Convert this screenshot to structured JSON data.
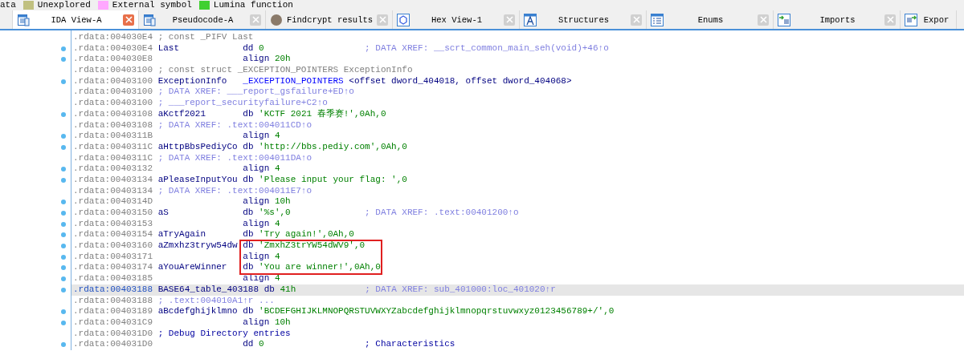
{
  "legend": [
    {
      "label": "ata"
    },
    {
      "label": "Unexplored",
      "color": "#c0c080"
    },
    {
      "label": "External symbol",
      "color": "#ffa8ff"
    },
    {
      "label": "Lumina function",
      "color": "#40d030"
    }
  ],
  "tabs": [
    {
      "label": "IDA View-A",
      "kind": "listing",
      "selected": true,
      "closable": true
    },
    {
      "label": "Pseudocode-A",
      "kind": "listing",
      "selected": false,
      "closable": true
    },
    {
      "label": "Findcrypt results",
      "kind": "avatar",
      "selected": false,
      "closable": true
    },
    {
      "label": "Hex View-1",
      "kind": "hex",
      "selected": false,
      "closable": true
    },
    {
      "label": "Structures",
      "kind": "struct",
      "selected": false,
      "closable": true
    },
    {
      "label": "Enums",
      "kind": "enum",
      "selected": false,
      "closable": true
    },
    {
      "label": "Imports",
      "kind": "imports",
      "selected": false,
      "closable": true
    },
    {
      "label": "Expor",
      "kind": "exports",
      "selected": false,
      "closable": false
    }
  ],
  "listing": {
    "lines": [
      {
        "address": ".rdata:004030E4",
        "dot": false,
        "highlighted": false,
        "boxed": false,
        "comment": {
          "text": "; const _PIFV Last",
          "kind": "note"
        }
      },
      {
        "address": ".rdata:004030E4",
        "dot": true,
        "highlighted": false,
        "boxed": false,
        "label": "Last",
        "mnemonic": "dd",
        "operands": [
          {
            "text": "0",
            "kind": "value"
          }
        ],
        "comment": {
          "text": "; DATA XREF: __scrt_common_main_seh(void)+46↑o",
          "kind": "xref"
        }
      },
      {
        "address": ".rdata:004030E8",
        "dot": true,
        "highlighted": false,
        "boxed": false,
        "mnemonic": "align",
        "operands": [
          {
            "text": "20h",
            "kind": "value"
          }
        ]
      },
      {
        "address": ".rdata:00403100",
        "dot": false,
        "highlighted": false,
        "boxed": false,
        "comment": {
          "text": "; const struct _EXCEPTION_POINTERS ExceptionInfo",
          "kind": "note"
        }
      },
      {
        "address": ".rdata:00403100",
        "dot": true,
        "highlighted": false,
        "boxed": false,
        "label": "ExceptionInfo",
        "operands": [
          {
            "text": "_EXCEPTION_POINTERS",
            "kind": "type"
          },
          {
            "text": "<offset dword_404018, offset dword_404068>",
            "kind": "ref"
          }
        ]
      },
      {
        "address": ".rdata:00403100",
        "dot": false,
        "highlighted": false,
        "boxed": false,
        "comment": {
          "text": "; DATA XREF: ___report_gsfailure+ED↑o",
          "kind": "xref"
        }
      },
      {
        "address": ".rdata:00403100",
        "dot": false,
        "highlighted": false,
        "boxed": false,
        "comment": {
          "text": "; ___report_securityfailure+C2↑o",
          "kind": "xref"
        }
      },
      {
        "address": ".rdata:00403108",
        "dot": true,
        "highlighted": false,
        "boxed": false,
        "label": "aKctf2021",
        "mnemonic": "db",
        "operands": [
          {
            "text": "'KCTF 2021 春季赛!',0Ah,0",
            "kind": "value"
          }
        ]
      },
      {
        "address": ".rdata:00403108",
        "dot": false,
        "highlighted": false,
        "boxed": false,
        "comment": {
          "text": "; DATA XREF: .text:004011CD↑o",
          "kind": "xref"
        }
      },
      {
        "address": ".rdata:0040311B",
        "dot": true,
        "highlighted": false,
        "boxed": false,
        "mnemonic": "align",
        "operands": [
          {
            "text": "4",
            "kind": "value"
          }
        ]
      },
      {
        "address": ".rdata:0040311C",
        "dot": true,
        "highlighted": false,
        "boxed": false,
        "label": "aHttpBbsPediyCo",
        "mnemonic": "db",
        "operands": [
          {
            "text": "'http://bbs.pediy.com',0Ah,0",
            "kind": "value"
          }
        ]
      },
      {
        "address": ".rdata:0040311C",
        "dot": false,
        "highlighted": false,
        "boxed": false,
        "comment": {
          "text": "; DATA XREF: .text:004011DA↑o",
          "kind": "xref"
        }
      },
      {
        "address": ".rdata:00403132",
        "dot": true,
        "highlighted": false,
        "boxed": false,
        "mnemonic": "align",
        "operands": [
          {
            "text": "4",
            "kind": "value"
          }
        ]
      },
      {
        "address": ".rdata:00403134",
        "dot": true,
        "highlighted": false,
        "boxed": false,
        "label": "aPleaseInputYou",
        "mnemonic": "db",
        "operands": [
          {
            "text": "'Please input your flag: ',0",
            "kind": "value"
          }
        ]
      },
      {
        "address": ".rdata:00403134",
        "dot": false,
        "highlighted": false,
        "boxed": false,
        "comment": {
          "text": "; DATA XREF: .text:004011E7↑o",
          "kind": "xref"
        }
      },
      {
        "address": ".rdata:0040314D",
        "dot": true,
        "highlighted": false,
        "boxed": false,
        "mnemonic": "align",
        "operands": [
          {
            "text": "10h",
            "kind": "value"
          }
        ]
      },
      {
        "address": ".rdata:00403150",
        "dot": true,
        "highlighted": false,
        "boxed": false,
        "label": "aS",
        "mnemonic": "db",
        "operands": [
          {
            "text": "'%s',0",
            "kind": "value"
          }
        ],
        "comment": {
          "text": "; DATA XREF: .text:00401200↑o",
          "kind": "xref"
        }
      },
      {
        "address": ".rdata:00403153",
        "dot": true,
        "highlighted": false,
        "boxed": false,
        "mnemonic": "align",
        "operands": [
          {
            "text": "4",
            "kind": "value"
          }
        ]
      },
      {
        "address": ".rdata:00403154",
        "dot": true,
        "highlighted": false,
        "boxed": false,
        "label": "aTryAgain",
        "mnemonic": "db",
        "operands": [
          {
            "text": "'Try again!',0Ah,0",
            "kind": "value"
          }
        ]
      },
      {
        "address": ".rdata:00403160",
        "dot": true,
        "highlighted": false,
        "boxed": true,
        "label": "aZmxhz3tryw54dw",
        "mnemonic": "db",
        "operands": [
          {
            "text": "'ZmxhZ3trYW54dWV9',0",
            "kind": "value"
          }
        ]
      },
      {
        "address": ".rdata:00403171",
        "dot": true,
        "highlighted": false,
        "boxed": true,
        "mnemonic": "align",
        "operands": [
          {
            "text": "4",
            "kind": "value"
          }
        ]
      },
      {
        "address": ".rdata:00403174",
        "dot": true,
        "highlighted": false,
        "boxed": true,
        "label": "aYouAreWinner",
        "mnemonic": "db",
        "operands": [
          {
            "text": "'You are winner!',0Ah,0",
            "kind": "value"
          }
        ]
      },
      {
        "address": ".rdata:00403185",
        "dot": true,
        "highlighted": false,
        "boxed": false,
        "mnemonic": "align",
        "operands": [
          {
            "text": "4",
            "kind": "value"
          }
        ]
      },
      {
        "address": ".rdata:00403188",
        "dot": true,
        "highlighted": true,
        "boxed": false,
        "label": "BASE64_table_403188",
        "mnemonic": "db",
        "operands": [
          {
            "text": "41h",
            "kind": "value"
          }
        ],
        "comment": {
          "text": "; DATA XREF: sub_401000:loc_401020↑r",
          "kind": "xref"
        }
      },
      {
        "address": ".rdata:00403188",
        "dot": false,
        "highlighted": false,
        "boxed": false,
        "comment": {
          "text": "; .text:004010A1↑r ...",
          "kind": "xref"
        }
      },
      {
        "address": ".rdata:00403189",
        "dot": true,
        "highlighted": false,
        "boxed": false,
        "label": "aBcdefghijklmno",
        "mnemonic": "db",
        "operands": [
          {
            "text": "'BCDEFGHIJKLMNOPQRSTUVWXYZabcdefghijklmnopqrstuvwxyz0123456789+/',0",
            "kind": "value"
          }
        ]
      },
      {
        "address": ".rdata:004031C9",
        "dot": true,
        "highlighted": false,
        "boxed": false,
        "mnemonic": "align",
        "operands": [
          {
            "text": "10h",
            "kind": "value"
          }
        ]
      },
      {
        "address": ".rdata:004031D0",
        "dot": false,
        "highlighted": false,
        "boxed": false,
        "comment": {
          "text": "; Debug Directory entries",
          "kind": "regular"
        }
      },
      {
        "address": ".rdata:004031D0",
        "dot": true,
        "highlighted": false,
        "boxed": false,
        "mnemonic": "dd",
        "operands": [
          {
            "text": "0",
            "kind": "value"
          }
        ],
        "comment": {
          "text": "; Characteristics",
          "kind": "regular"
        }
      }
    ]
  }
}
